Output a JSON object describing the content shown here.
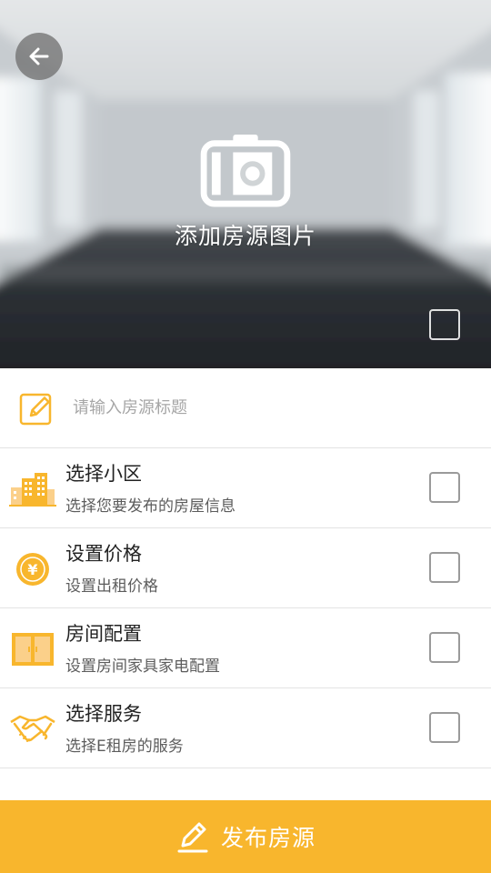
{
  "header": {
    "back_icon": "arrow-left-icon",
    "add_photo_label": "添加房源图片",
    "add_photo_icon": "camera-icon"
  },
  "title_field": {
    "icon": "edit-pencil-icon",
    "placeholder": "请输入房源标题",
    "value": ""
  },
  "options": [
    {
      "title": "选择小区",
      "subtitle": "选择您要发布的房屋信息",
      "icon": "buildings-icon",
      "checked": false
    },
    {
      "title": "设置价格",
      "subtitle": "设置出租价格",
      "icon": "yen-coin-icon",
      "checked": false
    },
    {
      "title": "房间配置",
      "subtitle": "设置房间家具家电配置",
      "icon": "wardrobe-icon",
      "checked": false
    },
    {
      "title": "选择服务",
      "subtitle": "选择E租房的服务",
      "icon": "handshake-icon",
      "checked": false
    }
  ],
  "publish": {
    "label": "发布房源",
    "icon": "pen-sign-icon"
  },
  "colors": {
    "accent": "#f8b62d",
    "divider": "#e3e3e3",
    "checkbox_border": "#9a9a9a"
  }
}
